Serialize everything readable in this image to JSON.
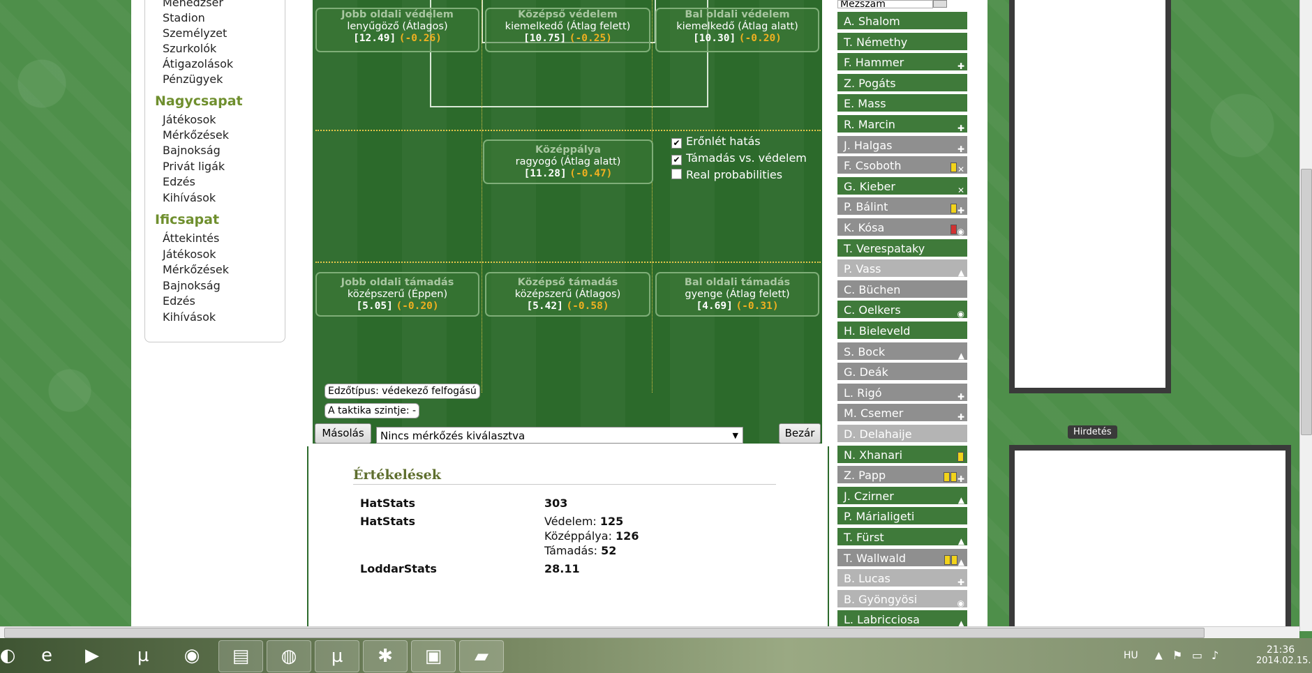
{
  "nav": {
    "items_top": [
      "Menedzser",
      "Stadion",
      "Személyzet",
      "Szurkolók",
      "Átigazolások",
      "Pénzügyek"
    ],
    "section1": "Nagycsapat",
    "items_mid": [
      "Játékosok",
      "Mérkőzések",
      "Bajnokság",
      "Privát ligák",
      "Edzés",
      "Kihívások"
    ],
    "section2": "Ificsapat",
    "items_bottom": [
      "Áttekintés",
      "Játékosok",
      "Mérkőzések",
      "Bajnokság",
      "Edzés",
      "Kihívások"
    ]
  },
  "pitch": {
    "def_right": {
      "title": "Jobb oldali védelem",
      "level": "lenyűgöző (Átlagos)",
      "value": "[12.49]",
      "delta": "(-0.26)"
    },
    "def_center": {
      "title": "Középső védelem",
      "level": "kiemelkedő (Átlag felett)",
      "value": "[10.75]",
      "delta": "(-0.25)"
    },
    "def_left": {
      "title": "Bal oldali védelem",
      "level": "kiemelkedő (Átlag alatt)",
      "value": "[10.30]",
      "delta": "(-0.20)"
    },
    "midfield": {
      "title": "Középpálya",
      "level": "ragyogó (Átlag alatt)",
      "value": "[11.28]",
      "delta": "(-0.47)"
    },
    "att_right": {
      "title": "Jobb oldali támadás",
      "level": "középszerű (Éppen)",
      "value": "[5.05]",
      "delta": "(-0.20)"
    },
    "att_center": {
      "title": "Középső támadás",
      "level": "középszerű (Átlagos)",
      "value": "[5.42]",
      "delta": "(-0.58)"
    },
    "att_left": {
      "title": "Bal oldali támadás",
      "level": "gyenge (Átlag felett)",
      "value": "[4.69]",
      "delta": "(-0.31)"
    },
    "options": [
      {
        "label": "Erőnlét hatás",
        "checked": true
      },
      {
        "label": "Támadás vs. védelem",
        "checked": true
      },
      {
        "label": "Real probabilities",
        "checked": false
      }
    ],
    "coach_type": "Edzőtípus: védekező felfogású",
    "tactic_level": "A taktika szintje: -",
    "copy_button": "Másolás",
    "match_select": "Nincs mérkőzés kiválasztva",
    "close_button": "Bezár"
  },
  "ratings": {
    "title": "Értékelések",
    "row1_label": "HatStats",
    "row1_value": "303",
    "row2_label": "HatStats",
    "row2_def_label": "Védelem:",
    "row2_def": "125",
    "row2_mid_label": "Középpálya:",
    "row2_mid": "126",
    "row2_att_label": "Támadás:",
    "row2_att": "52",
    "row3_label": "LoddarStats",
    "row3_value": "28.11"
  },
  "player_list": {
    "search_value": "Mezszám",
    "players": [
      {
        "name": "A. Shalom",
        "style": "g",
        "icons": ""
      },
      {
        "name": "T. Némethy",
        "style": "g",
        "icons": ""
      },
      {
        "name": "F. Hammer",
        "style": "g",
        "icons": "injury"
      },
      {
        "name": "Z. Pogáts",
        "style": "g",
        "icons": ""
      },
      {
        "name": "E. Mass",
        "style": "g",
        "icons": ""
      },
      {
        "name": "R. Marcin",
        "style": "g",
        "icons": "injury"
      },
      {
        "name": "J. Halgas",
        "style": "gr",
        "icons": "injury"
      },
      {
        "name": "F. Csoboth",
        "style": "gr",
        "icons": "yellow,tools"
      },
      {
        "name": "G. Kieber",
        "style": "g",
        "icons": "tools"
      },
      {
        "name": "P. Bálint",
        "style": "gr",
        "icons": "yellow,injury"
      },
      {
        "name": "K. Kósa",
        "style": "gr",
        "icons": "red,eye"
      },
      {
        "name": "T. Verespataky",
        "style": "g",
        "icons": ""
      },
      {
        "name": "P. Vass",
        "style": "lg",
        "icons": "cap"
      },
      {
        "name": "C. Büchen",
        "style": "gr",
        "icons": ""
      },
      {
        "name": "C. Oelkers",
        "style": "g",
        "icons": "eye"
      },
      {
        "name": "H. Bieleveld",
        "style": "g",
        "icons": ""
      },
      {
        "name": "S. Bock",
        "style": "gr",
        "icons": "cap"
      },
      {
        "name": "G. Deák",
        "style": "gr",
        "icons": ""
      },
      {
        "name": "L. Rigó",
        "style": "gr",
        "icons": "injury"
      },
      {
        "name": "M. Csemer",
        "style": "gr",
        "icons": "injury"
      },
      {
        "name": "D. Delahaije",
        "style": "lg",
        "icons": ""
      },
      {
        "name": "N. Xhanari",
        "style": "g",
        "icons": "yellow"
      },
      {
        "name": "Z. Papp",
        "style": "gr",
        "icons": "yellow,yellow,injury"
      },
      {
        "name": "J. Czirner",
        "style": "g",
        "icons": "cap"
      },
      {
        "name": "P. Márialigeti",
        "style": "g",
        "icons": ""
      },
      {
        "name": "T. Fürst",
        "style": "g",
        "icons": "cap"
      },
      {
        "name": "T. Wallwald",
        "style": "gr",
        "icons": "yellow,yellow,cap"
      },
      {
        "name": "B. Lucas",
        "style": "lg",
        "icons": "injury"
      },
      {
        "name": "B. Gyöngyösi",
        "style": "lg",
        "icons": "eye"
      },
      {
        "name": "L. Labricciosa",
        "style": "g",
        "icons": "cap"
      }
    ]
  },
  "ad_label": "Hirdetés",
  "taskbar": {
    "language": "HU",
    "time": "21:36",
    "date": "2014.02.15."
  },
  "colors": {
    "pitch": "#2c6a2b",
    "accent_delta": "#f0b020",
    "nav_heading": "#6f8f2e"
  }
}
